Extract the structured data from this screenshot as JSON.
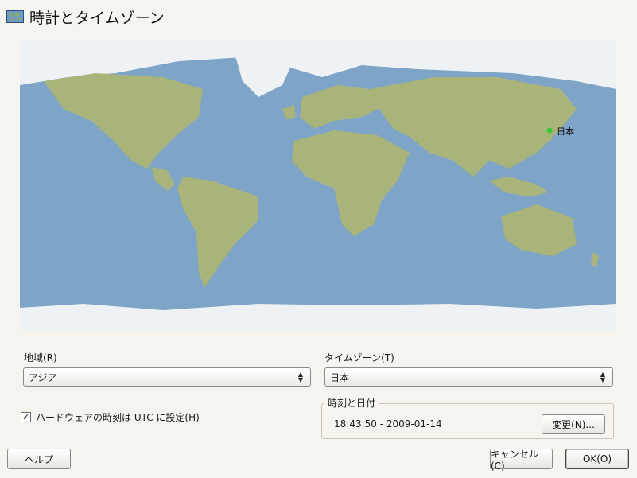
{
  "window": {
    "title": "時計とタイムゾーン",
    "icon": "world-map-icon"
  },
  "map": {
    "selected_label": "日本"
  },
  "region": {
    "label": "地域(R)",
    "value": "アジア"
  },
  "timezone": {
    "label": "タイムゾーン(T)",
    "value": "日本"
  },
  "hardware_utc": {
    "label": "ハードウェアの時刻は UTC に設定(H)",
    "checked": true,
    "mark": "✓"
  },
  "datetime": {
    "group_label": "時刻と日付",
    "value": "18:43:50 - 2009-01-14",
    "change_button": "変更(N)..."
  },
  "buttons": {
    "help": "ヘルプ",
    "cancel": "キャンセル(C)",
    "ok": "OK(O)"
  },
  "colors": {
    "ocean": "#7ea4c8",
    "land": "#a9b47a",
    "ice": "#eef2f4",
    "marker": "#33cc33",
    "city": "#c8e07a",
    "background": "#f6f4ee"
  }
}
